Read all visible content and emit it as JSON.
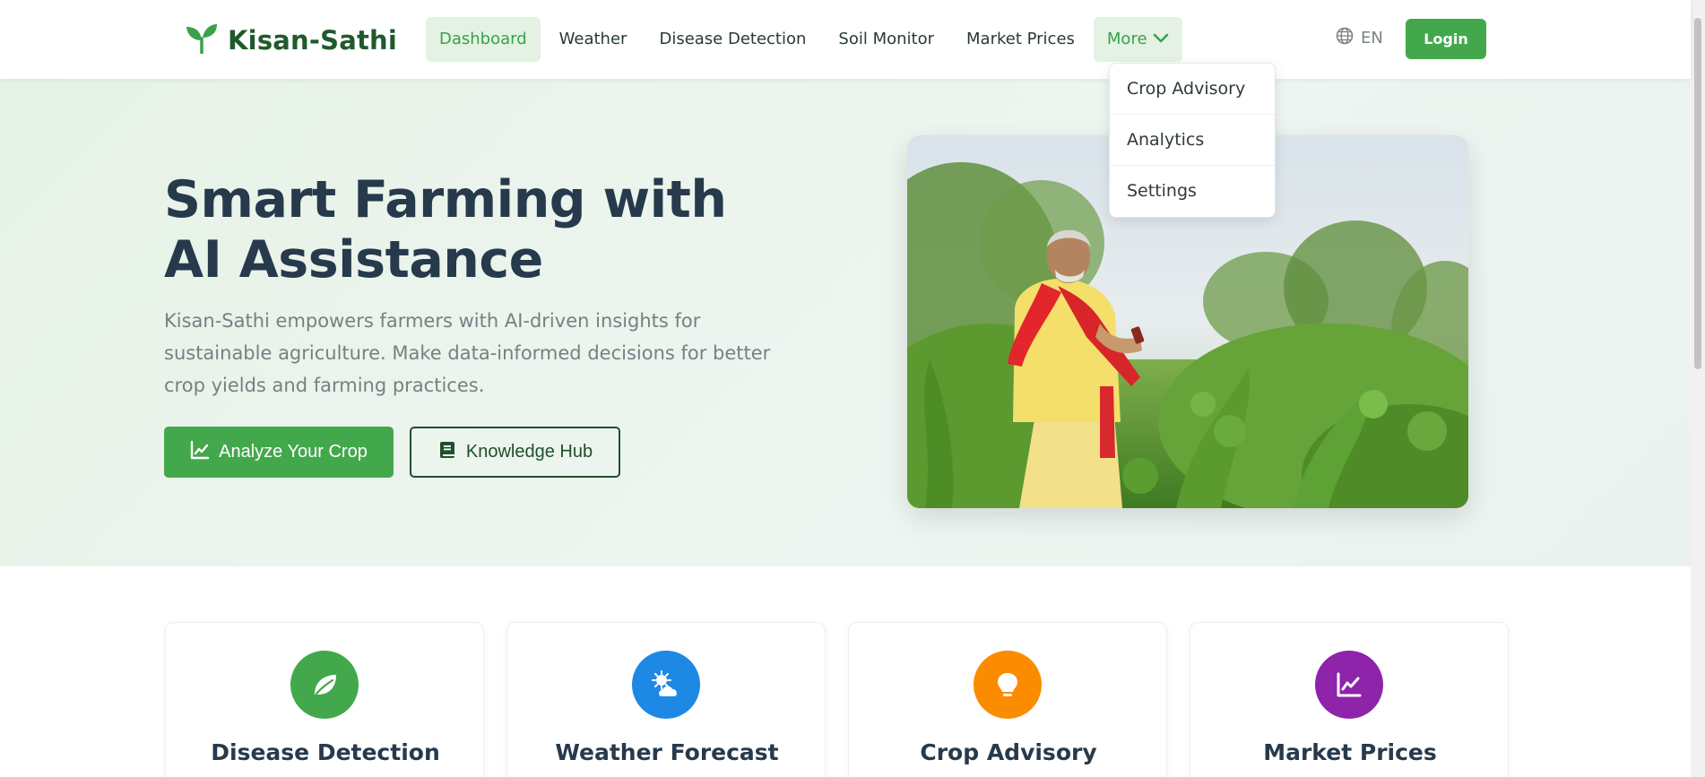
{
  "brand": {
    "name": "Kisan-Sathi",
    "color": "#1f5a2c"
  },
  "nav": {
    "items": [
      {
        "label": "Dashboard",
        "active": true
      },
      {
        "label": "Weather"
      },
      {
        "label": "Disease Detection"
      },
      {
        "label": "Soil Monitor"
      },
      {
        "label": "Market Prices"
      }
    ],
    "more_label": "More",
    "language": "EN",
    "login_label": "Login"
  },
  "dropdown": {
    "items": [
      "Crop Advisory",
      "Analytics",
      "Settings"
    ]
  },
  "hero": {
    "title": "Smart Farming with AI Assistance",
    "subtitle": "Kisan-Sathi empowers farmers with AI-driven insights for sustainable agriculture. Make data-informed decisions for better crop yields and farming practices.",
    "primary_button": {
      "label": "Analyze Your Crop",
      "icon": "chart-line-icon"
    },
    "secondary_button": {
      "label": "Knowledge Hub",
      "icon": "book-icon"
    }
  },
  "features": [
    {
      "title": "Disease Detection",
      "icon": "leaf-icon",
      "color": "#43a84c"
    },
    {
      "title": "Weather Forecast",
      "icon": "sun-cloud-icon",
      "color": "#1e88e5"
    },
    {
      "title": "Crop Advisory",
      "icon": "lightbulb-icon",
      "color": "#fb8c00"
    },
    {
      "title": "Market Prices",
      "icon": "chart-line-icon",
      "color": "#8e24aa"
    }
  ],
  "colors": {
    "primary": "#43a84c",
    "hero_text": "#263a4c"
  }
}
